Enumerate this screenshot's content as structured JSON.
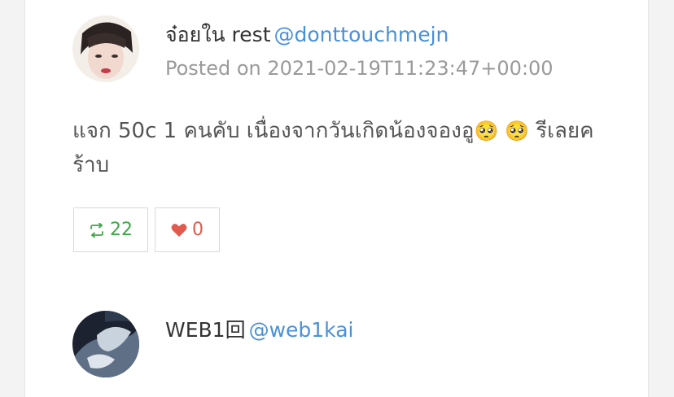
{
  "posts": [
    {
      "display_name": "จ๋อยใน rest",
      "handle": "@donttouchmejn",
      "timestamp": "Posted on 2021-02-19T11:23:47+00:00",
      "body": {
        "text_part1": "แจก 50c 1 คนคับ เนื่องจากวันเกิดน้องจองอู",
        "emoji": "🥺 🥺",
        "text_part2": " รีเลยคร้าบ"
      },
      "retweet_count": "22",
      "like_count": "0"
    },
    {
      "display_name": "WEB1回",
      "handle": "@web1kai"
    }
  ],
  "colors": {
    "handle": "#4a90d9",
    "retweet": "#3ea84a",
    "like": "#e05a4e",
    "timestamp": "#9a9a9a"
  },
  "icons": {
    "retweet": "retweet-icon",
    "like": "heart-icon"
  }
}
